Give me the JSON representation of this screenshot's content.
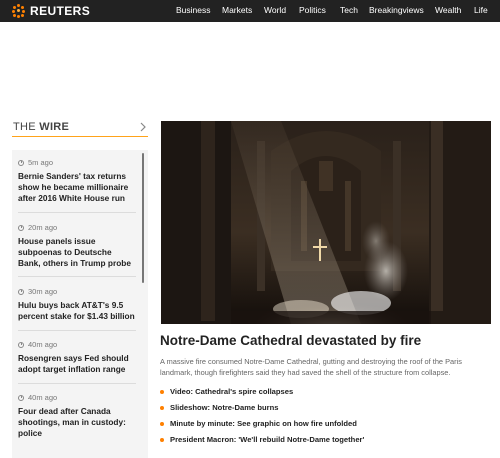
{
  "brand": {
    "name": "REUTERS",
    "accent": "#ff8000"
  },
  "nav": {
    "items": [
      "Business",
      "Markets",
      "World",
      "Politics",
      "Tech",
      "Breakingviews",
      "Wealth",
      "Life"
    ]
  },
  "wire": {
    "title_thin": "THE ",
    "title_bold": "WIRE",
    "chevron_icon": "chevron-right-icon",
    "items": [
      {
        "time": "5m ago",
        "headline": "Bernie Sanders' tax returns show he became millionaire after 2016 White House run"
      },
      {
        "time": "20m ago",
        "headline": "House panels issue subpoenas to Deutsche Bank, others in Trump probe"
      },
      {
        "time": "30m ago",
        "headline": "Hulu buys back AT&T's 9.5 percent stake for $1.43 billion"
      },
      {
        "time": "40m ago",
        "headline": "Rosengren says Fed should adopt target inflation range"
      },
      {
        "time": "40m ago",
        "headline": "Four dead after Canada shootings, man in custody: police"
      }
    ]
  },
  "lead": {
    "headline": "Notre-Dame Cathedral devastated by fire",
    "summary": "A massive fire consumed Notre-Dame Cathedral, gutting and destroying the roof of the Paris landmark, though firefighters said they had saved the shell of the structure from collapse.",
    "bullets": [
      "Video: Cathedral's spire collapses",
      "Slideshow: Notre-Dame burns",
      "Minute by minute: See graphic on how fire unfolded",
      "President Macron: 'We'll rebuild Notre-Dame together'"
    ]
  }
}
